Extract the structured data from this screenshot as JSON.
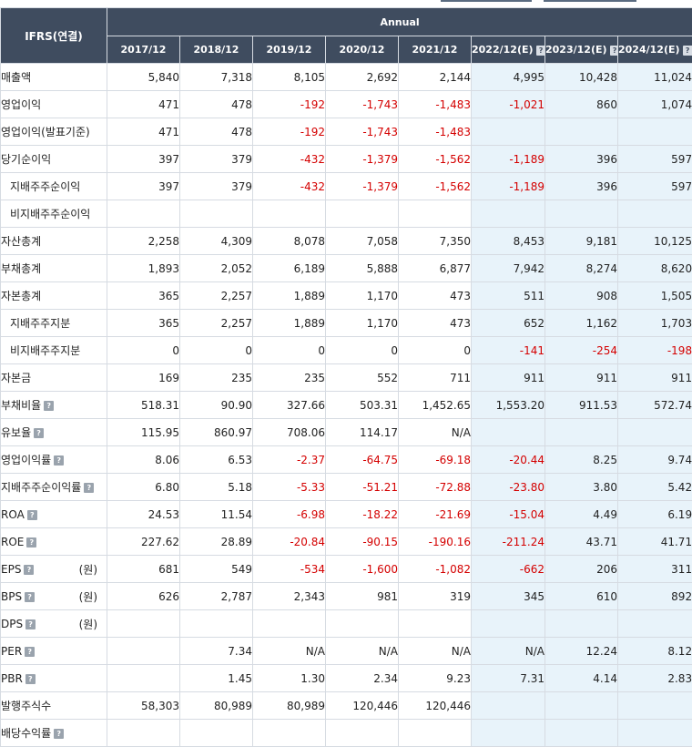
{
  "header": {
    "ifrs_label": "IFRS(연결)",
    "annual_label": "Annual",
    "periods": [
      {
        "label": "2017/12",
        "estimate": false
      },
      {
        "label": "2018/12",
        "estimate": false
      },
      {
        "label": "2019/12",
        "estimate": false
      },
      {
        "label": "2020/12",
        "estimate": false
      },
      {
        "label": "2021/12",
        "estimate": false
      },
      {
        "label": "2022/12(E)",
        "estimate": true
      },
      {
        "label": "2023/12(E)",
        "estimate": true
      },
      {
        "label": "2024/12(E)",
        "estimate": true
      }
    ]
  },
  "help_icon_glyph": "?",
  "colors": {
    "header_bg": "#3f4c5f",
    "estimate_bg": "#e8f3fa",
    "negative": "#d40000",
    "grid": "#d6dbe2"
  },
  "rows": [
    {
      "label": "매출액",
      "indent": false,
      "help": false,
      "unit": "",
      "values": [
        "5,840",
        "7,318",
        "8,105",
        "2,692",
        "2,144",
        "4,995",
        "10,428",
        "11,024"
      ]
    },
    {
      "label": "영업이익",
      "indent": false,
      "help": false,
      "unit": "",
      "values": [
        "471",
        "478",
        "-192",
        "-1,743",
        "-1,483",
        "-1,021",
        "860",
        "1,074"
      ]
    },
    {
      "label": "영업이익(발표기준)",
      "indent": false,
      "help": false,
      "unit": "",
      "values": [
        "471",
        "478",
        "-192",
        "-1,743",
        "-1,483",
        "",
        "",
        ""
      ]
    },
    {
      "label": "당기순이익",
      "indent": false,
      "help": false,
      "unit": "",
      "values": [
        "397",
        "379",
        "-432",
        "-1,379",
        "-1,562",
        "-1,189",
        "396",
        "597"
      ]
    },
    {
      "label": "지배주주순이익",
      "indent": true,
      "help": false,
      "unit": "",
      "values": [
        "397",
        "379",
        "-432",
        "-1,379",
        "-1,562",
        "-1,189",
        "396",
        "597"
      ]
    },
    {
      "label": "비지배주주순이익",
      "indent": true,
      "help": false,
      "unit": "",
      "values": [
        "",
        "",
        "",
        "",
        "",
        "",
        "",
        ""
      ]
    },
    {
      "label": "자산총계",
      "indent": false,
      "help": false,
      "unit": "",
      "values": [
        "2,258",
        "4,309",
        "8,078",
        "7,058",
        "7,350",
        "8,453",
        "9,181",
        "10,125"
      ]
    },
    {
      "label": "부채총계",
      "indent": false,
      "help": false,
      "unit": "",
      "values": [
        "1,893",
        "2,052",
        "6,189",
        "5,888",
        "6,877",
        "7,942",
        "8,274",
        "8,620"
      ]
    },
    {
      "label": "자본총계",
      "indent": false,
      "help": false,
      "unit": "",
      "values": [
        "365",
        "2,257",
        "1,889",
        "1,170",
        "473",
        "511",
        "908",
        "1,505"
      ]
    },
    {
      "label": "지배주주지분",
      "indent": true,
      "help": false,
      "unit": "",
      "values": [
        "365",
        "2,257",
        "1,889",
        "1,170",
        "473",
        "652",
        "1,162",
        "1,703"
      ]
    },
    {
      "label": "비지배주주지분",
      "indent": true,
      "help": false,
      "unit": "",
      "values": [
        "0",
        "0",
        "0",
        "0",
        "0",
        "-141",
        "-254",
        "-198"
      ]
    },
    {
      "label": "자본금",
      "indent": false,
      "help": false,
      "unit": "",
      "values": [
        "169",
        "235",
        "235",
        "552",
        "711",
        "911",
        "911",
        "911"
      ]
    },
    {
      "label": "부채비율",
      "indent": false,
      "help": true,
      "unit": "",
      "values": [
        "518.31",
        "90.90",
        "327.66",
        "503.31",
        "1,452.65",
        "1,553.20",
        "911.53",
        "572.74"
      ]
    },
    {
      "label": "유보율",
      "indent": false,
      "help": true,
      "unit": "",
      "values": [
        "115.95",
        "860.97",
        "708.06",
        "114.17",
        "N/A",
        "",
        "",
        ""
      ]
    },
    {
      "label": "영업이익률",
      "indent": false,
      "help": true,
      "unit": "",
      "values": [
        "8.06",
        "6.53",
        "-2.37",
        "-64.75",
        "-69.18",
        "-20.44",
        "8.25",
        "9.74"
      ]
    },
    {
      "label": "지배주주순이익률",
      "indent": false,
      "help": true,
      "unit": "",
      "values": [
        "6.80",
        "5.18",
        "-5.33",
        "-51.21",
        "-72.88",
        "-23.80",
        "3.80",
        "5.42"
      ]
    },
    {
      "label": "ROA",
      "indent": false,
      "help": true,
      "unit": "",
      "values": [
        "24.53",
        "11.54",
        "-6.98",
        "-18.22",
        "-21.69",
        "-15.04",
        "4.49",
        "6.19"
      ]
    },
    {
      "label": "ROE",
      "indent": false,
      "help": true,
      "unit": "",
      "values": [
        "227.62",
        "28.89",
        "-20.84",
        "-90.15",
        "-190.16",
        "-211.24",
        "43.71",
        "41.71"
      ]
    },
    {
      "label": "EPS",
      "indent": false,
      "help": true,
      "unit": "(원)",
      "values": [
        "681",
        "549",
        "-534",
        "-1,600",
        "-1,082",
        "-662",
        "206",
        "311"
      ]
    },
    {
      "label": "BPS",
      "indent": false,
      "help": true,
      "unit": "(원)",
      "values": [
        "626",
        "2,787",
        "2,343",
        "981",
        "319",
        "345",
        "610",
        "892"
      ]
    },
    {
      "label": "DPS",
      "indent": false,
      "help": true,
      "unit": "(원)",
      "values": [
        "",
        "",
        "",
        "",
        "",
        "",
        "",
        ""
      ]
    },
    {
      "label": "PER",
      "indent": false,
      "help": true,
      "unit": "",
      "values": [
        "",
        "7.34",
        "N/A",
        "N/A",
        "N/A",
        "N/A",
        "12.24",
        "8.12"
      ]
    },
    {
      "label": "PBR",
      "indent": false,
      "help": true,
      "unit": "",
      "values": [
        "",
        "1.45",
        "1.30",
        "2.34",
        "9.23",
        "7.31",
        "4.14",
        "2.83"
      ]
    },
    {
      "label": "발행주식수",
      "indent": false,
      "help": false,
      "unit": "",
      "values": [
        "58,303",
        "80,989",
        "80,989",
        "120,446",
        "120,446",
        "",
        "",
        ""
      ]
    },
    {
      "label": "배당수익률",
      "indent": false,
      "help": true,
      "unit": "",
      "values": [
        "",
        "",
        "",
        "",
        "",
        "",
        "",
        ""
      ]
    }
  ]
}
